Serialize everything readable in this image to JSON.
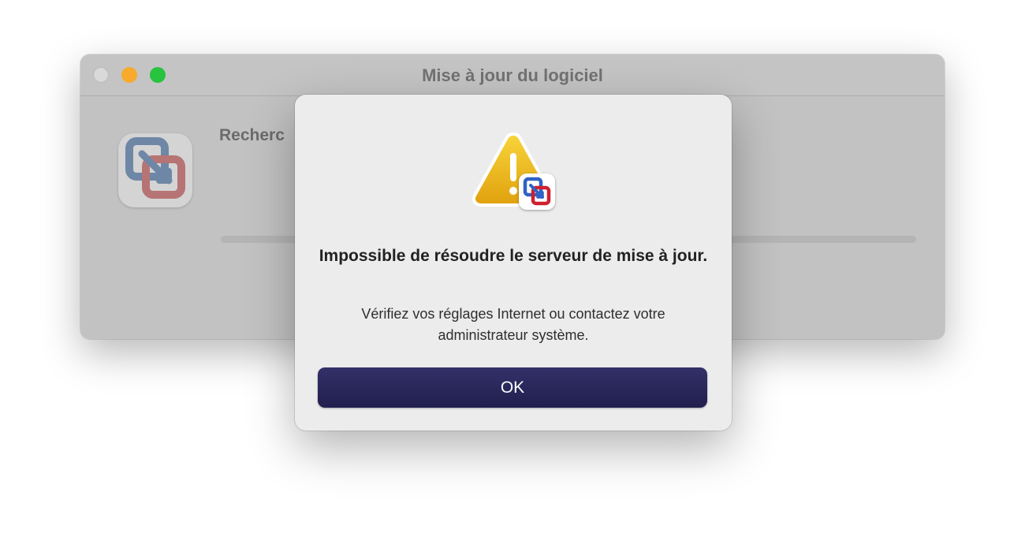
{
  "window": {
    "title": "Mise à jour du logiciel",
    "status_label": "Recherc",
    "app_icon": "vmware-fusion-icon"
  },
  "dialog": {
    "icon": "warning-icon",
    "badge_icon": "vmware-fusion-icon",
    "title": "Impossible de résoudre le serveur de mise à jour.",
    "message": "Vérifiez vos réglages Internet ou contactez votre administrateur système.",
    "ok_label": "OK"
  },
  "colors": {
    "close_button": "#d9d9d9",
    "minimize_button": "#f7aa2c",
    "zoom_button": "#28c33f",
    "ok_button": "#2a2759",
    "warning_triangle": "#f2be1a"
  }
}
